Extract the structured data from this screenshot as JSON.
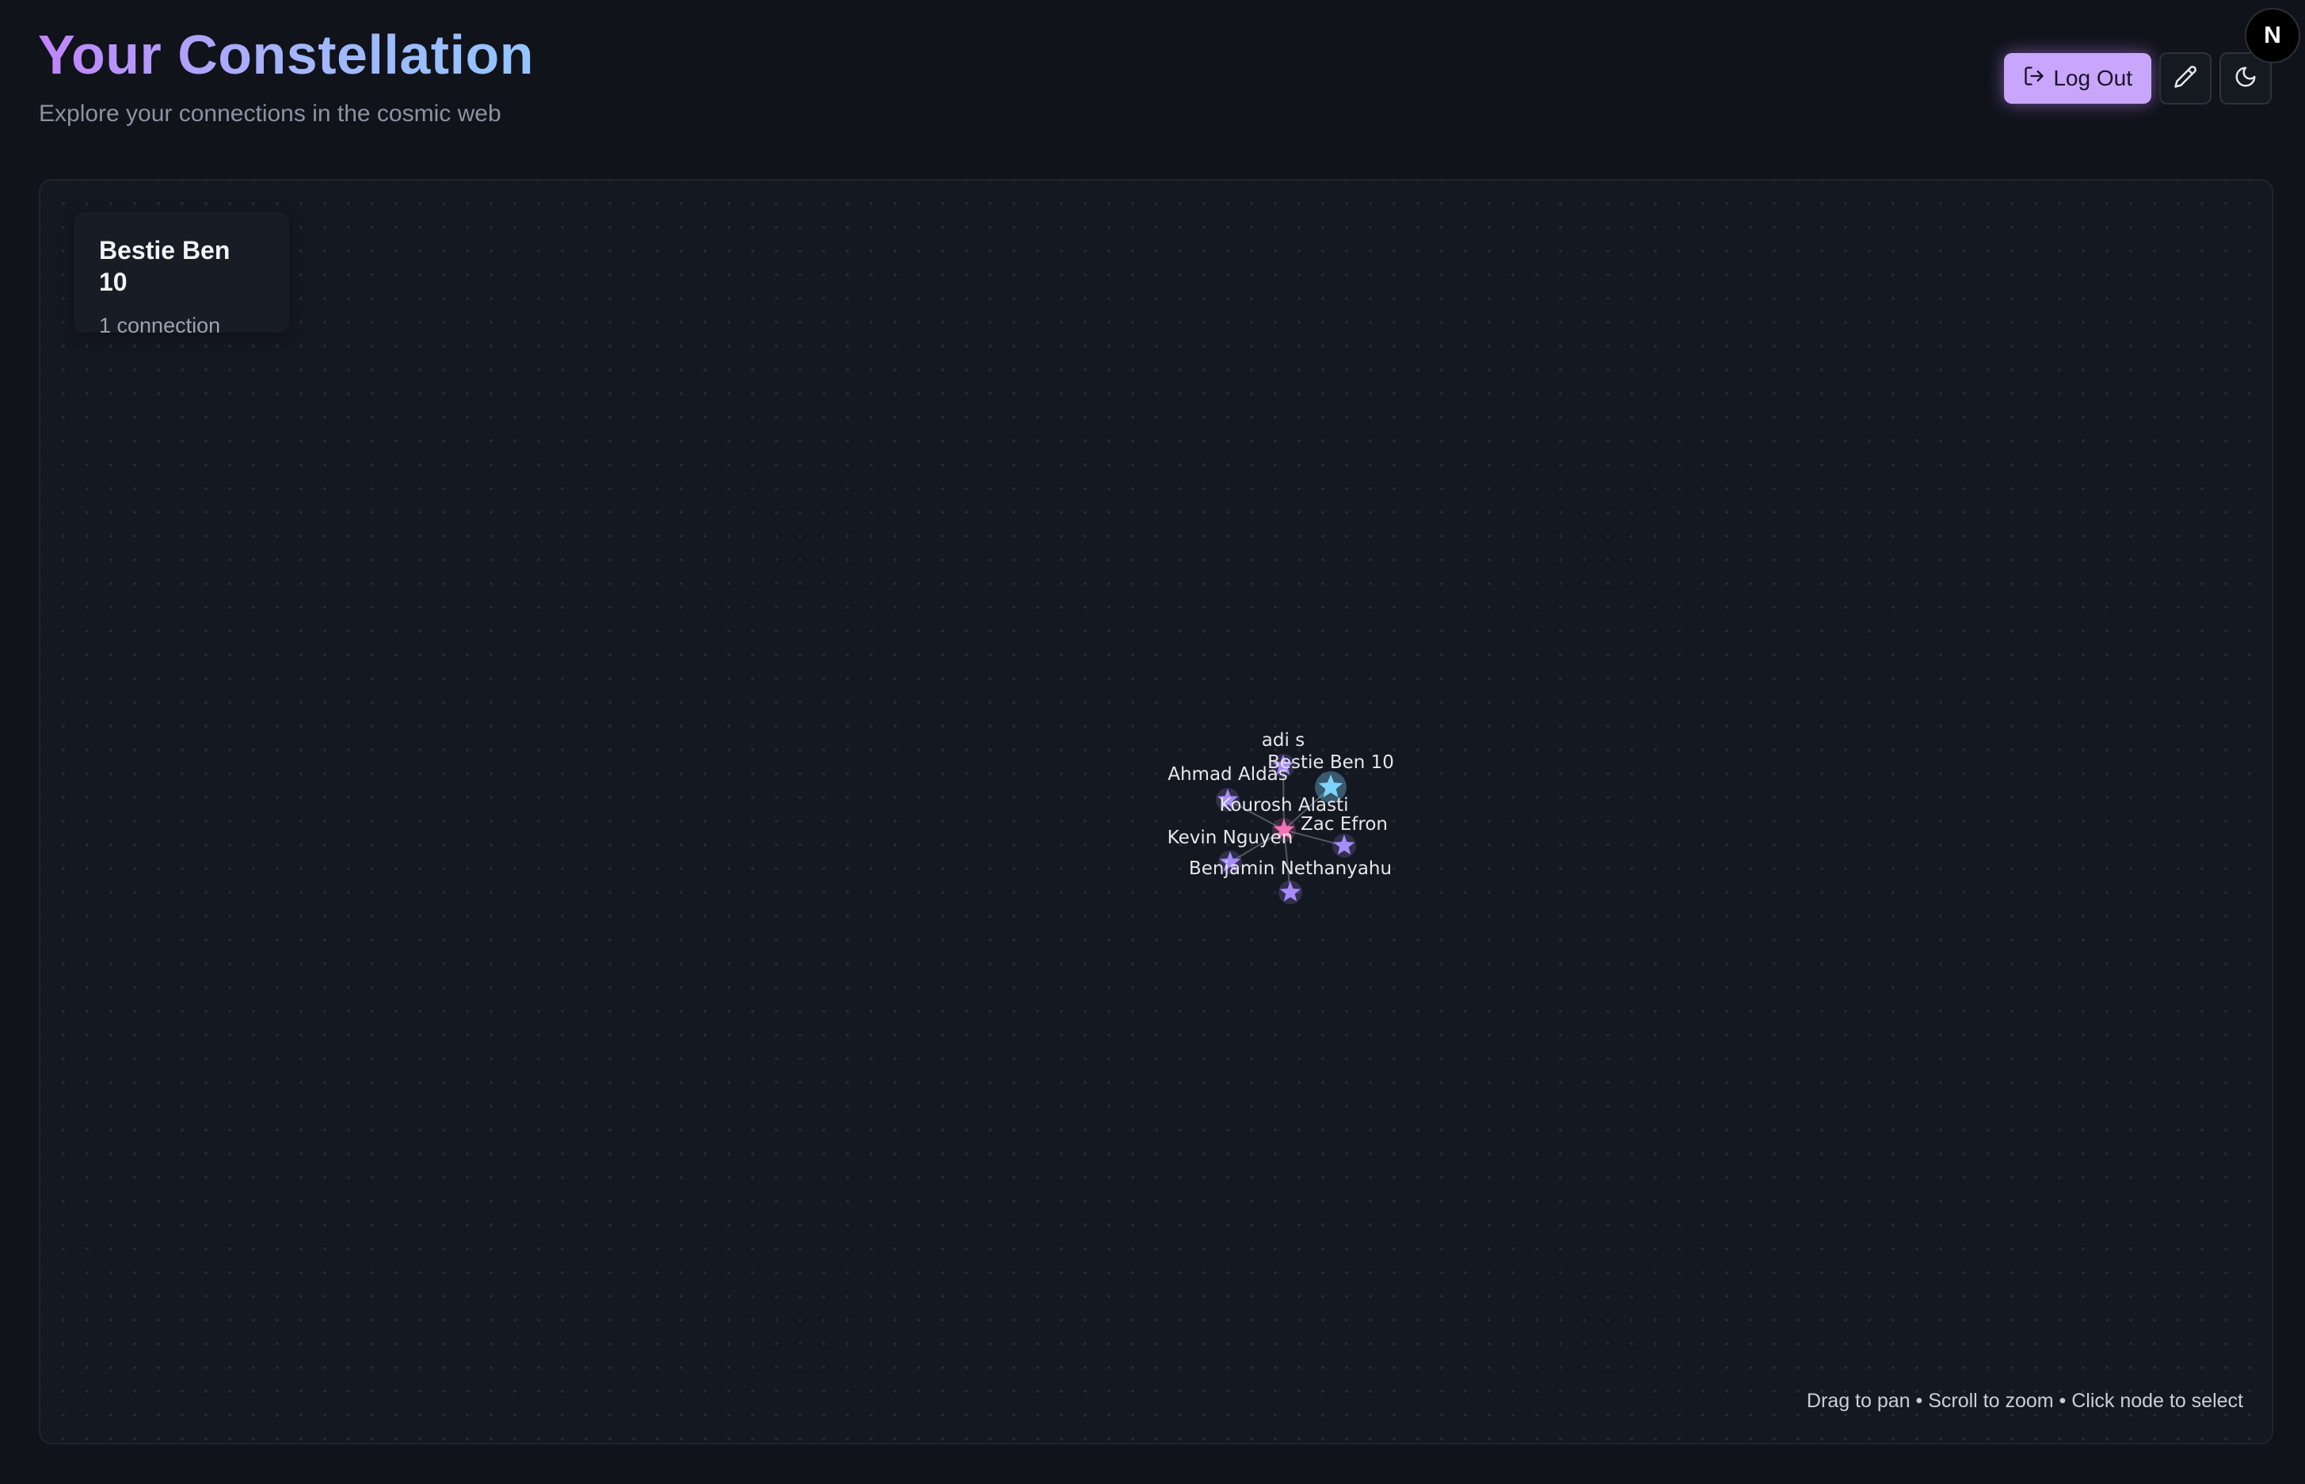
{
  "header": {
    "title": "Your Constellation",
    "subtitle": "Explore your connections in the cosmic web"
  },
  "toolbar": {
    "logout_label": "Log Out",
    "logout_icon": "log-out-icon",
    "edit_icon": "pencil-icon",
    "theme_icon": "moon-icon",
    "badge_letter": "N"
  },
  "selected": {
    "name": "Bestie Ben 10",
    "connections": "1 connection"
  },
  "graph": {
    "nodes": [
      {
        "id": "adi",
        "label": "adi s",
        "color": "#a78bfa",
        "type": "friend"
      },
      {
        "id": "ben10",
        "label": "Bestie Ben 10",
        "color": "#7dd3fc",
        "type": "selected"
      },
      {
        "id": "ahmad",
        "label": "Ahmad Aldas",
        "color": "#a78bfa",
        "type": "friend"
      },
      {
        "id": "kourosh",
        "label": "Kourosh Alasti",
        "color": "#f472b6",
        "type": "self"
      },
      {
        "id": "zac",
        "label": "Zac Efron",
        "color": "#a78bfa",
        "type": "friend"
      },
      {
        "id": "kevin",
        "label": "Kevin Nguyen",
        "color": "#a78bfa",
        "type": "friend"
      },
      {
        "id": "benjamin",
        "label": "Benjamin Nethanyahu",
        "color": "#a78bfa",
        "type": "friend"
      }
    ],
    "edges": [
      [
        "kourosh",
        "adi"
      ],
      [
        "kourosh",
        "ben10"
      ],
      [
        "kourosh",
        "ahmad"
      ],
      [
        "kourosh",
        "zac"
      ],
      [
        "kourosh",
        "kevin"
      ],
      [
        "kourosh",
        "benjamin"
      ]
    ]
  },
  "hint": "Drag to pan • Scroll to zoom • Click node to select",
  "colors": {
    "accent": "#c7a6fb",
    "node_friend": "#a78bfa",
    "node_selected": "#7dd3fc",
    "node_self": "#f472b6"
  }
}
